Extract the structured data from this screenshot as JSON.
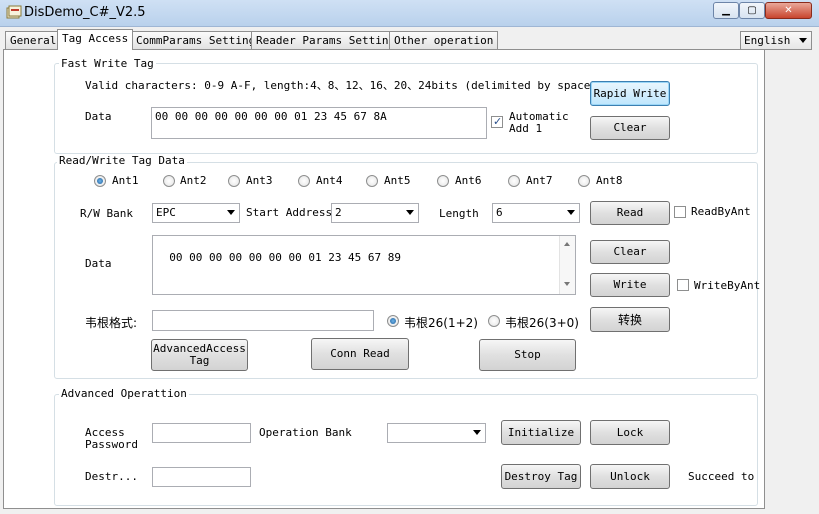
{
  "window": {
    "title": "DisDemo_C#_V2.5"
  },
  "tabs": [
    {
      "label": "General"
    },
    {
      "label": "Tag Access"
    },
    {
      "label": "CommParams Setting"
    },
    {
      "label": "Reader Params Setting"
    },
    {
      "label": "Other operation"
    }
  ],
  "language": {
    "selected": "English"
  },
  "fast_write": {
    "legend": "Fast Write Tag",
    "hint": "Valid characters: 0-9 A-F, length:4、8、12、16、20、24bits (delimited by space)",
    "data_label": "Data",
    "data_value": "00 00 00 00 00 00 00 01 23 45 67 8A",
    "auto_add_line1": "Automatic",
    "auto_add_line2": "Add 1",
    "auto_add_checked": true,
    "rapid_write": "Rapid Write",
    "clear": "Clear"
  },
  "rw": {
    "legend": "Read/Write Tag Data",
    "antennas": [
      "Ant1",
      "Ant2",
      "Ant3",
      "Ant4",
      "Ant5",
      "Ant6",
      "Ant7",
      "Ant8"
    ],
    "selected_antenna": "Ant1",
    "bank_label": "R/W Bank",
    "bank_value": "EPC",
    "start_label": "Start Address",
    "start_value": "2",
    "length_label": "Length",
    "length_value": "6",
    "read": "Read",
    "read_by_ant": "ReadByAnt",
    "data_label": "Data",
    "data_value": "00 00 00 00 00 00 00 01 23 45 67 89",
    "clear": "Clear",
    "write": "Write",
    "write_by_ant": "WriteByAnt",
    "wiegand_label": "韦根格式:",
    "wiegand_value": "",
    "wiegand_opt1": "韦根26(1+2)",
    "wiegand_opt2": "韦根26(3+0)",
    "convert": "转换",
    "advanced_line1": "AdvancedAccess",
    "advanced_line2": "Tag",
    "conn_read": "Conn Read",
    "stop": "Stop"
  },
  "adv": {
    "legend": "Advanced Operattion",
    "access_line1": "Access",
    "access_line2": "Password",
    "access_value": "",
    "op_bank_label": "Operation Bank",
    "op_bank_value": "",
    "initialize": "Initialize",
    "lock": "Lock",
    "destroy_label": "Destr...",
    "destroy_value": "",
    "destroy_tag": "Destroy Tag",
    "unlock": "Unlock",
    "status": "Succeed to w"
  }
}
